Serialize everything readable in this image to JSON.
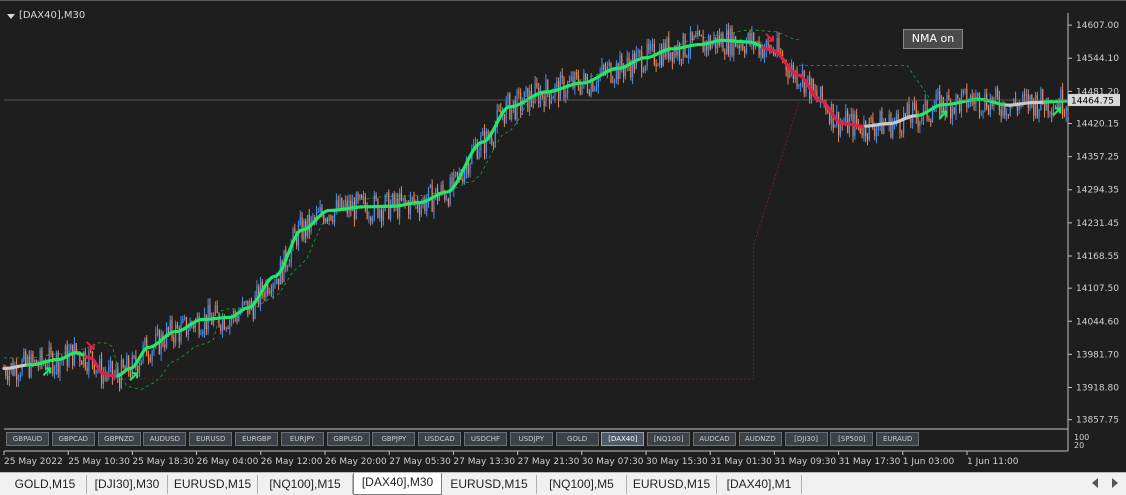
{
  "chart_title": "[DAX40],M30",
  "nma_button_label": "NMA on",
  "current_price_label": "14464.75",
  "vol_labels": [
    "100",
    "20"
  ],
  "symbol_buttons": [
    "GBPAUD",
    "GBPCAD",
    "GBPNZD",
    "AUDUSD",
    "EURUSD",
    "EURGBP",
    "EURJPY",
    "GBPUSD",
    "GBPJPY",
    "USDCAD",
    "USDCHF",
    "USDJPY",
    "GOLD",
    "[DAX40]",
    "[NQ100]",
    "AUDCAD",
    "AUDNZD",
    "[DJI30]",
    "[SP500]",
    "EURAUD"
  ],
  "active_symbol": "[DAX40]",
  "tabs": [
    "GOLD,M15",
    "[DJI30],M30",
    "EURUSD,M15",
    "[NQ100],M15",
    "[DAX40],M30",
    "EURUSD,M15",
    "[NQ100],M5",
    "EURUSD,M15",
    "[DAX40],M1"
  ],
  "active_tab": 4,
  "colors": {
    "background": "#1e1e1e",
    "bull_candle": "#4a8fe8",
    "bear_candle": "#e8875a",
    "ma_up": "#22e86a",
    "ma_down": "#e0204a",
    "ma_flat": "#c8c8c8",
    "grid_text": "#d0d0d0"
  },
  "chart_data": {
    "type": "line",
    "ylim": [
      13840,
      14630
    ],
    "yticks": [
      "14607.00",
      "14544.10",
      "14481.20",
      "14420.15",
      "14357.25",
      "14294.35",
      "14231.45",
      "14168.55",
      "14107.50",
      "14044.60",
      "13981.70",
      "13918.80",
      "13857.75"
    ],
    "ytick_values": [
      14607.0,
      14544.1,
      14481.2,
      14420.15,
      14357.25,
      14294.35,
      14231.45,
      14168.55,
      14107.5,
      14044.6,
      13981.7,
      13918.8,
      13857.75
    ],
    "xticks": [
      "25 May 2022",
      "25 May 10:30",
      "25 May 18:30",
      "26 May 04:00",
      "26 May 12:00",
      "26 May 20:00",
      "27 May 05:30",
      "27 May 13:30",
      "27 May 21:30",
      "30 May 07:30",
      "30 May 15:30",
      "31 May 01:30",
      "31 May 09:30",
      "31 May 17:30",
      "1 Jun 03:00",
      "1 Jun 11:00"
    ],
    "current_price": 14464.75,
    "ma_anchors": [
      [
        0,
        13955
      ],
      [
        15,
        13962
      ],
      [
        30,
        13972
      ],
      [
        40,
        13985
      ],
      [
        48,
        13975
      ],
      [
        55,
        13945
      ],
      [
        62,
        13940
      ],
      [
        70,
        13955
      ],
      [
        80,
        13995
      ],
      [
        95,
        14025
      ],
      [
        110,
        14048
      ],
      [
        125,
        14052
      ],
      [
        135,
        14070
      ],
      [
        150,
        14130
      ],
      [
        165,
        14218
      ],
      [
        180,
        14255
      ],
      [
        200,
        14262
      ],
      [
        215,
        14263
      ],
      [
        230,
        14270
      ],
      [
        245,
        14290
      ],
      [
        265,
        14385
      ],
      [
        280,
        14452
      ],
      [
        300,
        14480
      ],
      [
        320,
        14497
      ],
      [
        340,
        14525
      ],
      [
        355,
        14545
      ],
      [
        370,
        14562
      ],
      [
        385,
        14570
      ],
      [
        398,
        14578
      ],
      [
        412,
        14575
      ],
      [
        425,
        14560
      ],
      [
        440,
        14512
      ],
      [
        452,
        14463
      ],
      [
        464,
        14420
      ],
      [
        476,
        14415
      ],
      [
        490,
        14420
      ],
      [
        505,
        14435
      ],
      [
        520,
        14456
      ],
      [
        540,
        14466
      ],
      [
        556,
        14455
      ],
      [
        570,
        14460
      ],
      [
        590,
        14463
      ]
    ],
    "ma_down_ranges": [
      [
        45,
        62
      ],
      [
        420,
        476
      ]
    ],
    "ma_flat_ranges": [
      [
        0,
        12
      ],
      [
        476,
        505
      ],
      [
        555,
        575
      ]
    ],
    "candles_count": 590
  }
}
